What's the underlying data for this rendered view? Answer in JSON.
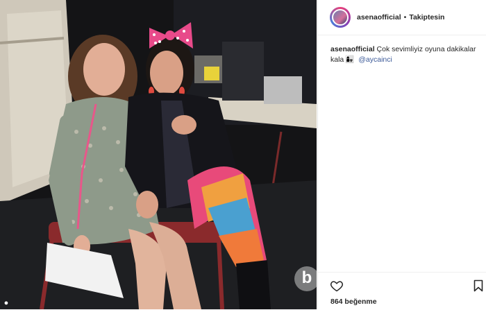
{
  "post": {
    "username": "asenaofficial",
    "separator": "•",
    "follow_status": "Takiptesin",
    "caption_username": "asenaofficial",
    "caption_text": "Çok sevimliyiz oyuna dakikalar kala",
    "caption_emoji": "👩‍👧",
    "caption_mention": "@aycainci",
    "likes": "864 beğenme"
  },
  "photo": {
    "description_icons": [
      "heart-icon",
      "bookmark-icon"
    ],
    "watermark_letter": "b",
    "corner_icon_glyph": "●"
  },
  "colors": {
    "background": "#ffffff",
    "text": "#262626",
    "mention": "#3b5998",
    "border": "#efefef"
  }
}
